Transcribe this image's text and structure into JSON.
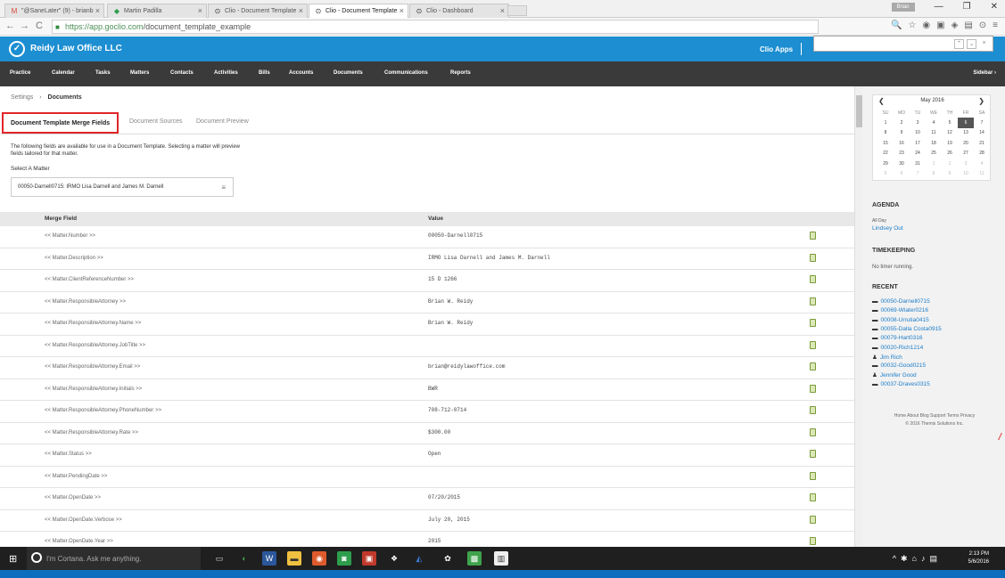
{
  "browser": {
    "tabs": [
      {
        "label": "\"@SaneLater\" (9) - brianb",
        "icon": "M",
        "color": "#d44638"
      },
      {
        "label": "Martin Padilla",
        "icon": "◆",
        "color": "#2e9e4c"
      },
      {
        "label": "Clio - Document Template",
        "icon": "⊙",
        "color": "#333"
      },
      {
        "label": "Clio - Document Template",
        "icon": "⊙",
        "color": "#333",
        "active": true
      },
      {
        "label": "Clio - Dashboard",
        "icon": "⊙",
        "color": "#333"
      }
    ],
    "url_host": "https://app.goclio.com",
    "url_path": "/document_template_example",
    "user_badge": "Brian",
    "find_prev": "⌃",
    "find_next": "⌄",
    "find_close": "×"
  },
  "app": {
    "firm_name": "Reidy Law Office LLC",
    "clio_apps": "Clio Apps",
    "nav": [
      "Practice",
      "Calendar",
      "Tasks",
      "Matters",
      "Contacts",
      "Activities",
      "Bills",
      "Accounts",
      "Documents",
      "Communications",
      "Reports"
    ],
    "sidebar_toggle": "Sidebar ›"
  },
  "breadcrumb": {
    "parent": "Settings",
    "separator": "›",
    "current": "Documents"
  },
  "subtabs": [
    "Document Template Merge Fields",
    "Document Sources",
    "Document Preview"
  ],
  "description": "The following fields are available for use in a Document Template. Selecting a matter will preview fields tailored for that matter.",
  "select_matter_label": "Select A Matter",
  "selected_matter": "00050-Darnell0715: IRMO Lisa Darnell and James M. Darnell",
  "table": {
    "headers": [
      "Merge Field",
      "Value"
    ],
    "rows": [
      {
        "field": "<< Matter.Number >>",
        "value": "00050-Darnell0715"
      },
      {
        "field": "<< Matter.Description >>",
        "value": "IRMO Lisa Darnell and James M. Darnell"
      },
      {
        "field": "<< Matter.ClientReferenceNumber >>",
        "value": "15 D 1266"
      },
      {
        "field": "<< Matter.ResponsibleAttorney >>",
        "value": "Brian W. Reidy"
      },
      {
        "field": "<< Matter.ResponsibleAttorney.Name >>",
        "value": "Brian W. Reidy"
      },
      {
        "field": "<< Matter.ResponsibleAttorney.JobTitle >>",
        "value": ""
      },
      {
        "field": "<< Matter.ResponsibleAttorney.Email >>",
        "value": "brian@reidylawoffice.com"
      },
      {
        "field": "<< Matter.ResponsibleAttorney.Initials >>",
        "value": "BWR"
      },
      {
        "field": "<< Matter.ResponsibleAttorney.PhoneNumber >>",
        "value": "708-712-0714"
      },
      {
        "field": "<< Matter.ResponsibleAttorney.Rate >>",
        "value": "$300.00"
      },
      {
        "field": "<< Matter.Status >>",
        "value": "Open"
      },
      {
        "field": "<< Matter.PendingDate >>",
        "value": ""
      },
      {
        "field": "<< Matter.OpenDate >>",
        "value": "07/20/2015"
      },
      {
        "field": "<< Matter.OpenDate.Verbose >>",
        "value": "July 20, 2015"
      },
      {
        "field": "<< Matter.OpenDate.Year >>",
        "value": "2015"
      }
    ]
  },
  "calendar": {
    "month": "May 2016",
    "dow": [
      "SU",
      "MO",
      "TU",
      "WE",
      "TH",
      "FR",
      "SA"
    ],
    "weeks": [
      [
        "1",
        "2",
        "3",
        "4",
        "5",
        "6",
        "7"
      ],
      [
        "8",
        "9",
        "10",
        "11",
        "12",
        "13",
        "14"
      ],
      [
        "15",
        "16",
        "17",
        "18",
        "19",
        "20",
        "21"
      ],
      [
        "22",
        "23",
        "24",
        "25",
        "26",
        "27",
        "28"
      ],
      [
        "29",
        "30",
        "31",
        "1",
        "2",
        "3",
        "4"
      ],
      [
        "5",
        "6",
        "7",
        "8",
        "9",
        "10",
        "11"
      ]
    ],
    "today": "6"
  },
  "agenda": {
    "title": "AGENDA",
    "item_time": "All Day",
    "item_name": "Lindsey Out"
  },
  "timekeeping": {
    "title": "TIMEKEEPING",
    "status": "No timer running."
  },
  "recent": {
    "title": "RECENT",
    "items": [
      {
        "type": "matter",
        "label": "00050-Darnell0715"
      },
      {
        "type": "matter",
        "label": "00069-Wiater0216"
      },
      {
        "type": "matter",
        "label": "00008-Urrutia0415"
      },
      {
        "type": "matter",
        "label": "00055-Dalla Costa0915"
      },
      {
        "type": "matter",
        "label": "00079-Hart0316"
      },
      {
        "type": "matter",
        "label": "00020-Rich1214"
      },
      {
        "type": "contact",
        "label": "Jim Rich"
      },
      {
        "type": "matter",
        "label": "00032-Good0215"
      },
      {
        "type": "contact",
        "label": "Jennifer Good"
      },
      {
        "type": "matter",
        "label": "00037-Draves0315"
      }
    ]
  },
  "footer": {
    "links": "Home  About  Blog  Support  Terms  Privacy",
    "copyright": "© 2016 Themis Solutions Inc."
  },
  "taskbar": {
    "cortana": "I'm Cortana. Ask me anything.",
    "time": "2:13 PM",
    "date": "5/6/2016"
  },
  "colors": {
    "brand": "#1c8ed1",
    "nav_dark": "#3a3a3a",
    "highlight": "#e0262a",
    "link": "#1c7dc9"
  }
}
